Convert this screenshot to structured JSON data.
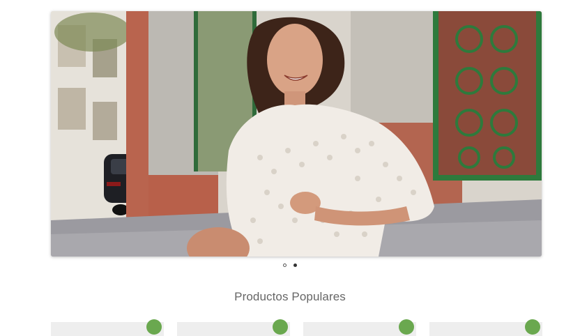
{
  "hero": {
    "image_alt": "Mujer sonriente con blusa blanca de encaje",
    "slides": [
      {
        "active": true
      },
      {
        "active": false
      }
    ]
  },
  "section": {
    "title": "Productos Populares"
  },
  "products": [
    {
      "badge_color": "#6aa84f"
    },
    {
      "badge_color": "#6aa84f"
    },
    {
      "badge_color": "#6aa84f"
    },
    {
      "badge_color": "#6aa84f"
    }
  ],
  "colors": {
    "accent": "#6aa84f",
    "title_text": "#666666"
  }
}
